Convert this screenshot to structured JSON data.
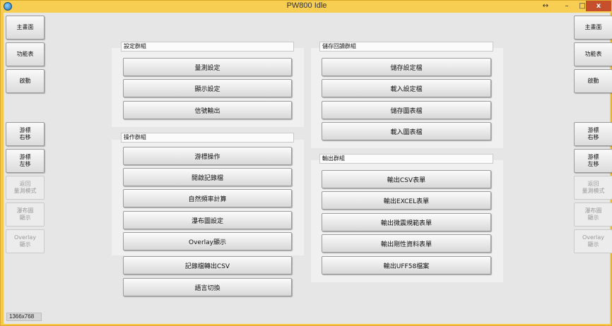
{
  "window": {
    "title": "PW800 Idle",
    "restore_glyph": "↔",
    "minimize_glyph": "–",
    "maximize_glyph": "□",
    "close_glyph": "x"
  },
  "status": {
    "resolution": "1366x768"
  },
  "left_sidebar": [
    {
      "label": "主畫面",
      "enabled": true
    },
    {
      "label": "功能表",
      "enabled": true
    },
    {
      "label": "啟動",
      "enabled": true
    },
    {
      "label": "游標\n右移",
      "enabled": true
    },
    {
      "label": "游標\n左移",
      "enabled": true
    },
    {
      "label": "返回\n量測模式",
      "enabled": false
    },
    {
      "label": "瀑布圖\n顯示",
      "enabled": false
    },
    {
      "label": "Overlay\n顯示",
      "enabled": false
    }
  ],
  "right_sidebar": [
    {
      "label": "主畫面",
      "enabled": true
    },
    {
      "label": "功能表",
      "enabled": true
    },
    {
      "label": "啟動",
      "enabled": true
    },
    {
      "label": "游標\n右移",
      "enabled": true
    },
    {
      "label": "游標\n左移",
      "enabled": true
    },
    {
      "label": "返回\n量測模式",
      "enabled": false
    },
    {
      "label": "瀑布圖\n顯示",
      "enabled": false
    },
    {
      "label": "Overlay\n顯示",
      "enabled": false
    }
  ],
  "groups": {
    "settings": {
      "title": "設定群組",
      "buttons": [
        "量測設定",
        "顯示設定",
        "信號輸出"
      ]
    },
    "operations": {
      "title": "操作群組",
      "buttons": [
        "游標操作",
        "開啟記錄檔",
        "自然頻率計算",
        "瀑布圖設定",
        "Overlay顯示"
      ]
    },
    "extra_buttons": [
      "記錄檔轉出CSV",
      "語言切換"
    ],
    "storage": {
      "title": "儲存回讀群組",
      "buttons": [
        "儲存設定檔",
        "載入設定檔",
        "儲存圖表檔",
        "載入圖表檔"
      ]
    },
    "output": {
      "title": "輸出群組",
      "buttons": [
        "輸出CSV表單",
        "輸出EXCEL表單",
        "輸出微震規範表單",
        "輸出剛性資料表單",
        "輸出UFF58檔案"
      ]
    }
  }
}
